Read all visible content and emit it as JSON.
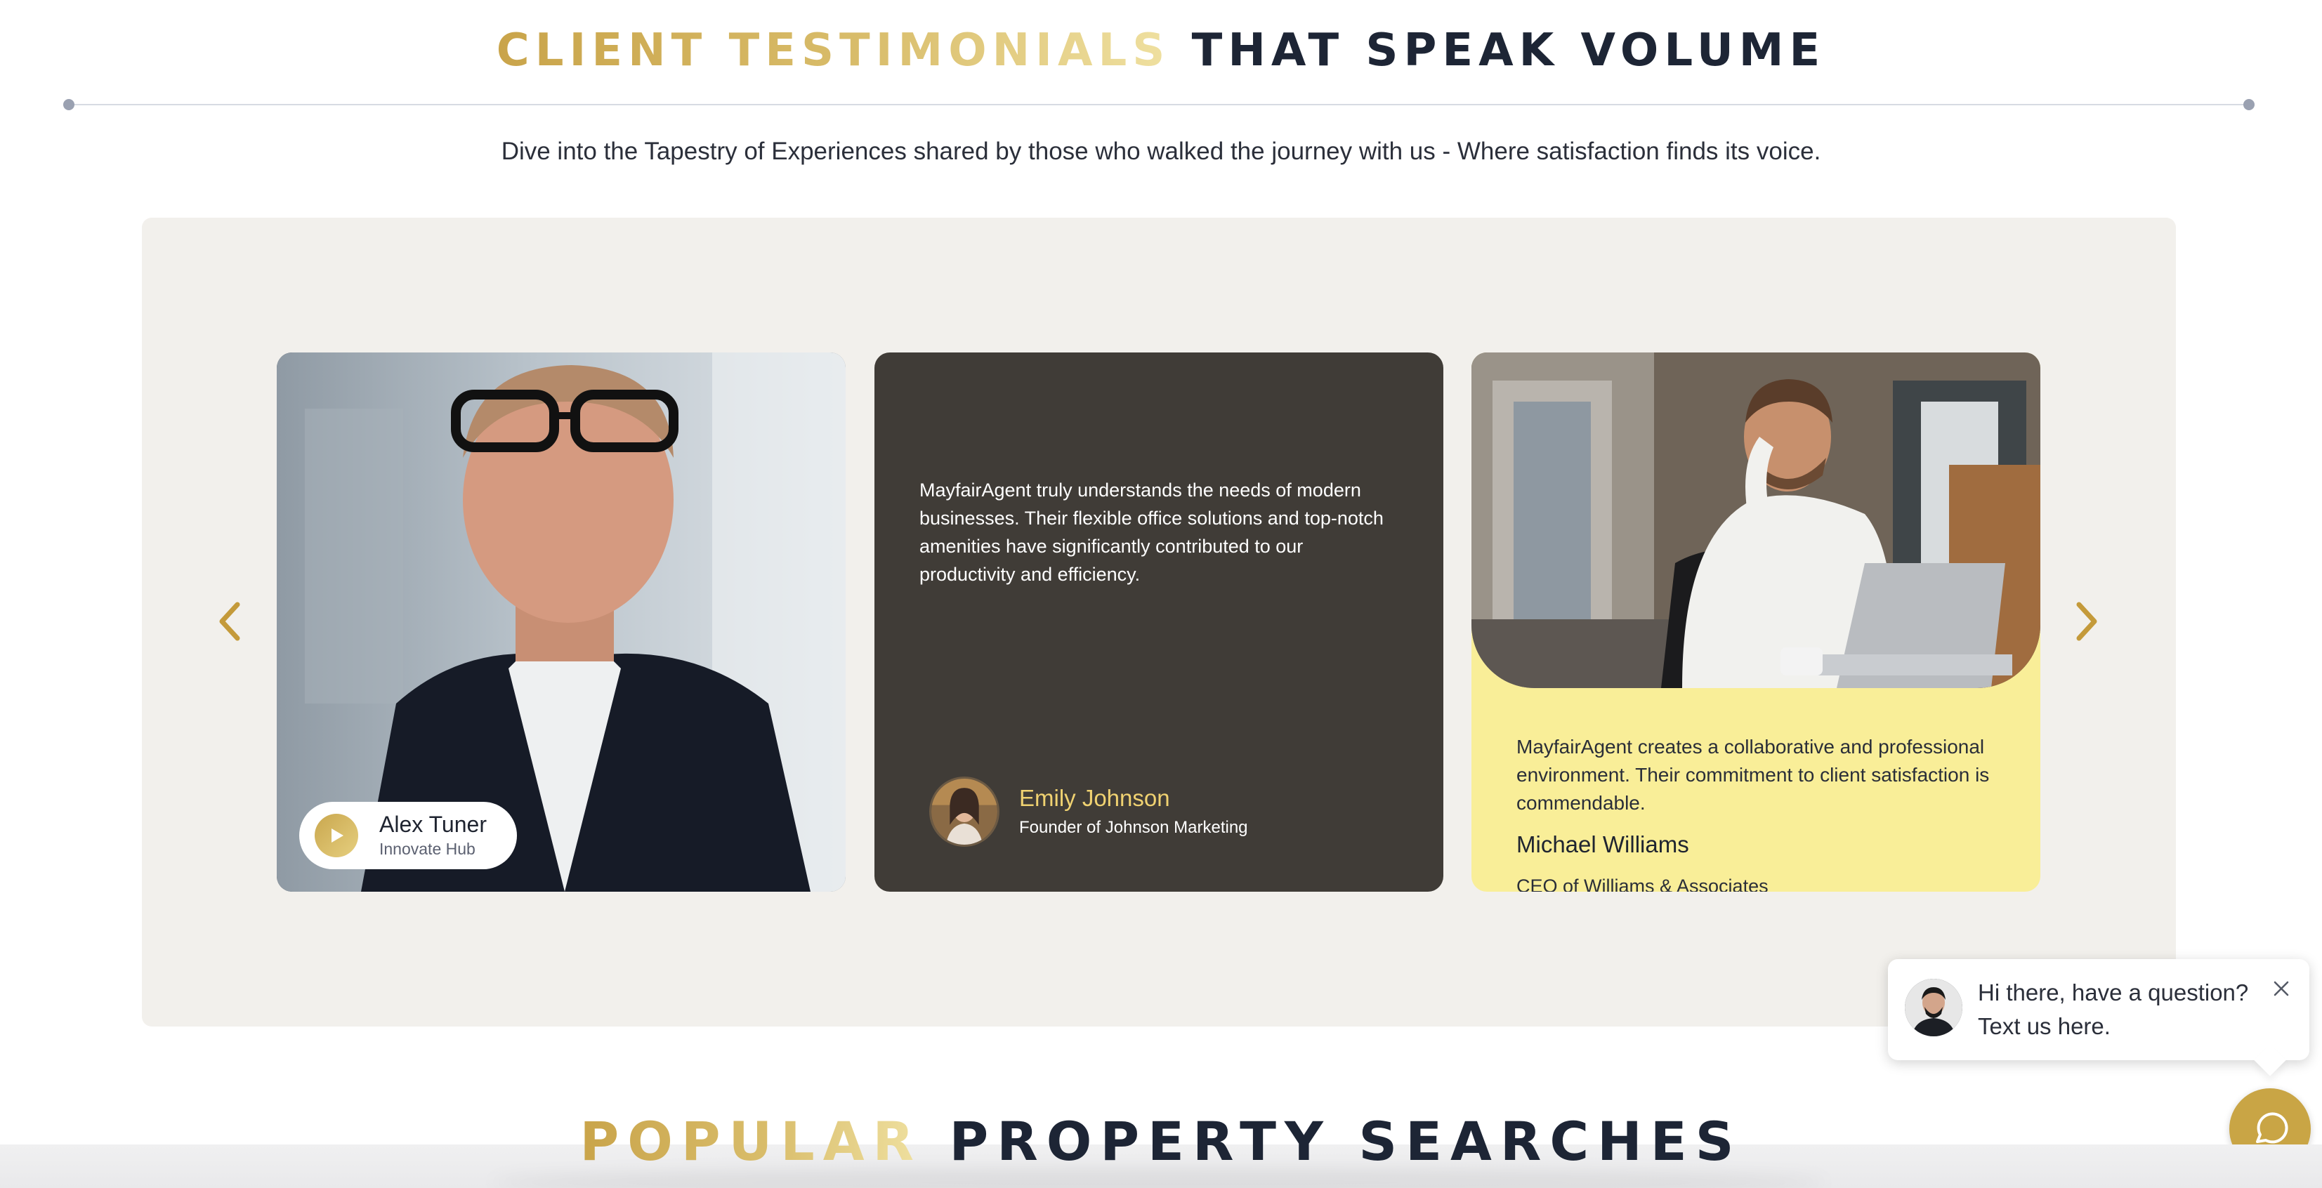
{
  "testimonials_section": {
    "title_gold": "CLIENT TESTIMONIALS",
    "title_dark": "THAT SPEAK VOLUME",
    "subtitle": "Dive into the Tapestry of Experiences shared by those who walked the journey with us - Where satisfaction finds its voice.",
    "prev_icon": "chevron-left-icon",
    "next_icon": "chevron-right-icon",
    "cards": [
      {
        "type": "video",
        "name": "Alex Tuner",
        "company": "Innovate Hub",
        "icon": "play-icon"
      },
      {
        "type": "quote-dark",
        "quote": "MayfairAgent truly understands the needs of modern businesses. Their flexible office solutions and top-notch amenities have significantly contributed to our productivity and efficiency.",
        "name": "Emily Johnson",
        "role": "Founder of Johnson Marketing"
      },
      {
        "type": "quote-light",
        "quote": "MayfairAgent creates a collaborative and professional environment. Their commitment to client satisfaction is commendable.",
        "name": "Michael Williams",
        "role": "CEO of Williams & Associates"
      }
    ]
  },
  "popular_section": {
    "title_gold": "POPULAR",
    "title_dark": "PROPERTY SEARCHES"
  },
  "chat_widget": {
    "message": "Hi there, have a question? Text us here.",
    "close_icon": "close-icon",
    "launcher_icon": "chat-bubble-icon"
  },
  "colors": {
    "gold": "#c9a545",
    "navy": "#1d2535",
    "panel": "#f2f0ec",
    "dark_card": "#403c37",
    "light_card": "#f9ee98",
    "author_name": "#f0d271"
  }
}
